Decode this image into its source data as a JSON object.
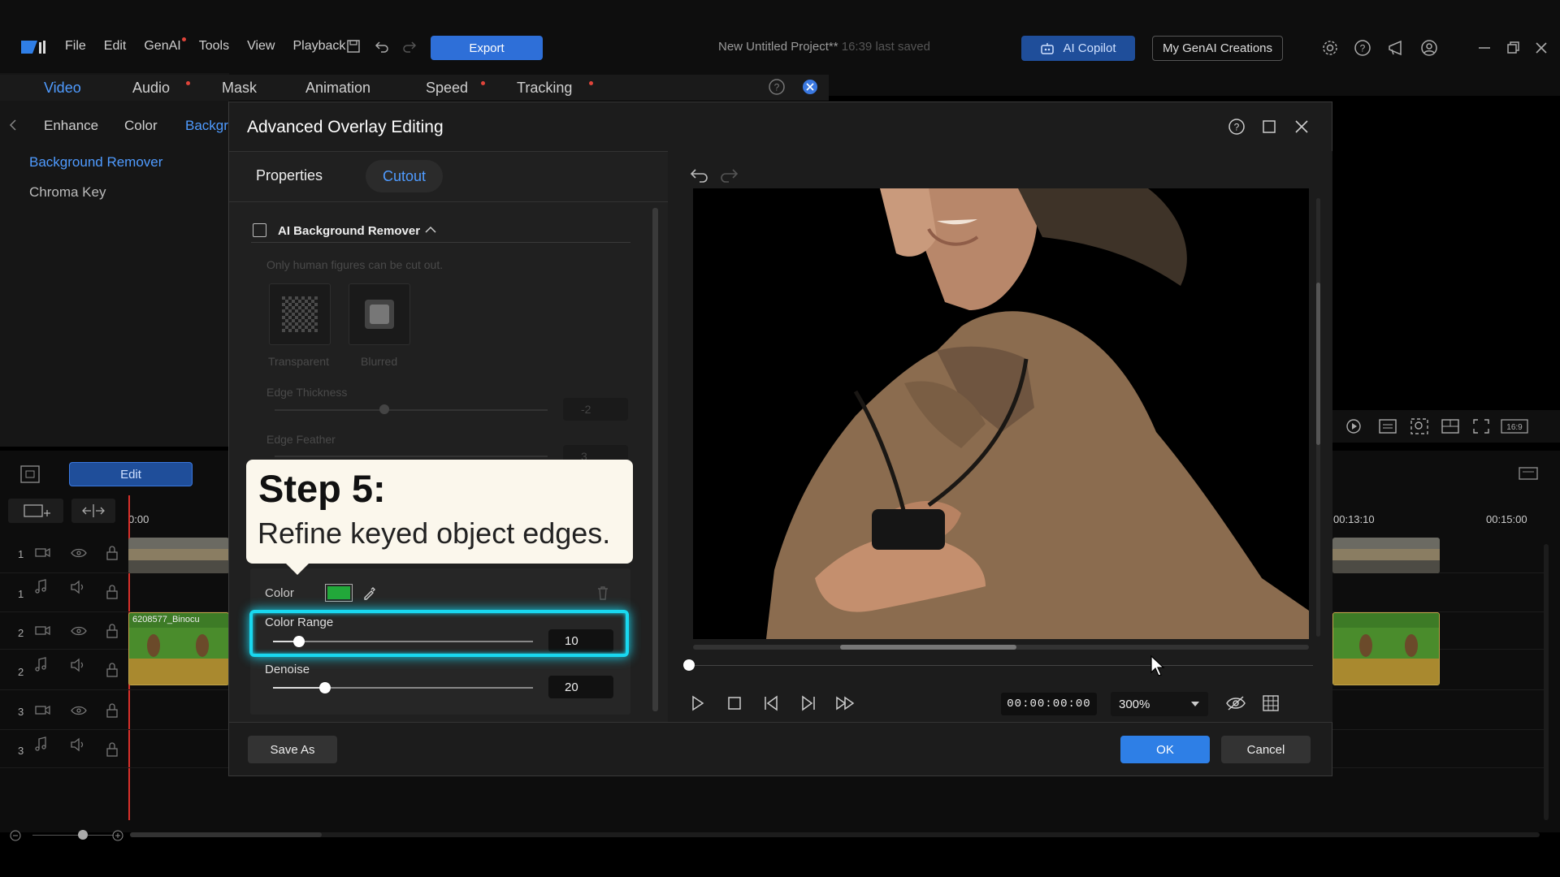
{
  "menu": {
    "items": [
      "File",
      "Edit",
      "GenAI",
      "Tools",
      "View",
      "Playback"
    ]
  },
  "toolbar": {
    "export_label": "Export"
  },
  "project": {
    "title": "New Untitled Project**",
    "saved": "16:39 last saved"
  },
  "header": {
    "copilot_label": "AI Copilot",
    "creations_label": "My GenAI Creations"
  },
  "main_tabs": [
    {
      "label": "Video",
      "dot": false
    },
    {
      "label": "Audio",
      "dot": true
    },
    {
      "label": "Mask",
      "dot": false
    },
    {
      "label": "Animation",
      "dot": false
    },
    {
      "label": "Speed",
      "dot": true
    },
    {
      "label": "Tracking",
      "dot": true
    }
  ],
  "sub_tabs": [
    "Enhance",
    "Color",
    "Backgr"
  ],
  "side_list": [
    "Background Remover",
    "Chroma Key"
  ],
  "timeline": {
    "edit_label": "Edit",
    "start_time": "0:00",
    "times": [
      "00:13:10",
      "00:15:00"
    ],
    "track_numbers": [
      "1",
      "1",
      "2",
      "2",
      "3",
      "3"
    ],
    "clip_label": "6208577_Binocu"
  },
  "dialog": {
    "title": "Advanced Overlay Editing",
    "tabs": {
      "properties": "Properties",
      "cutout": "Cutout"
    },
    "ai_bg_remover": "AI Background Remover",
    "hint": "Only human figures can be cut out.",
    "options": {
      "transparent": "Transparent",
      "blurred": "Blurred"
    },
    "edge_thickness": {
      "label": "Edge Thickness",
      "value": "-2"
    },
    "edge_feather": {
      "label": "Edge Feather",
      "value": "3"
    },
    "color_label": "Color",
    "color_value": "#22a83a",
    "color_range": {
      "label": "Color Range",
      "value": "10",
      "level": 0.1
    },
    "denoise": {
      "label": "Denoise",
      "value": "20",
      "level": 0.2
    },
    "callout": {
      "title": "Step 5:",
      "body": "Refine keyed object edges."
    },
    "timecode": "00:00:00:00",
    "zoom": "300%",
    "buttons": {
      "save_as": "Save As",
      "ok": "OK",
      "cancel": "Cancel"
    }
  },
  "colors": {
    "accent": "#2e7fe6",
    "highlight": "#19d8f0",
    "active_tab": "#4f9bff"
  }
}
